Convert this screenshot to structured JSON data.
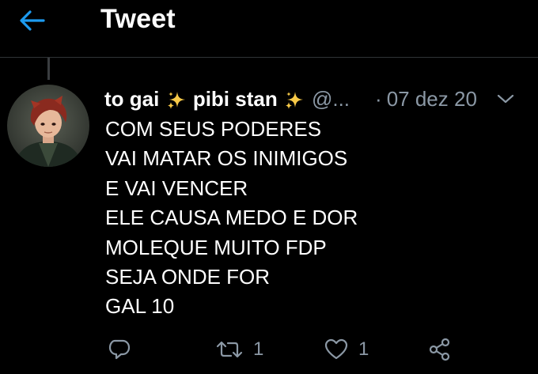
{
  "header": {
    "title": "Tweet",
    "back_icon": "arrow-left-icon",
    "accent": "#1d9bf0"
  },
  "tweet": {
    "author": {
      "name_part1": "to gai",
      "name_part2": "pibi stan",
      "handle": "@...",
      "sparkle_icon": "sparkles-emoji",
      "sparkle_color": "#f7c948"
    },
    "dot": "·",
    "date": "07 dez 20",
    "lines": [
      "COM SEUS PODERES",
      "VAI MATAR OS INIMIGOS",
      "E VAI VENCER",
      "ELE CAUSA MEDO E DOR",
      "MOLEQUE MUITO FDP",
      "SEJA ONDE FOR",
      "GAL 10"
    ],
    "actions": {
      "reply_icon": "reply-icon",
      "retweet_icon": "retweet-icon",
      "retweet_count": "1",
      "like_icon": "heart-icon",
      "like_count": "1",
      "share_icon": "share-icon"
    }
  },
  "colors": {
    "background": "#000000",
    "text": "#ffffff",
    "muted": "#8b98a5",
    "divider": "#2f3336"
  }
}
